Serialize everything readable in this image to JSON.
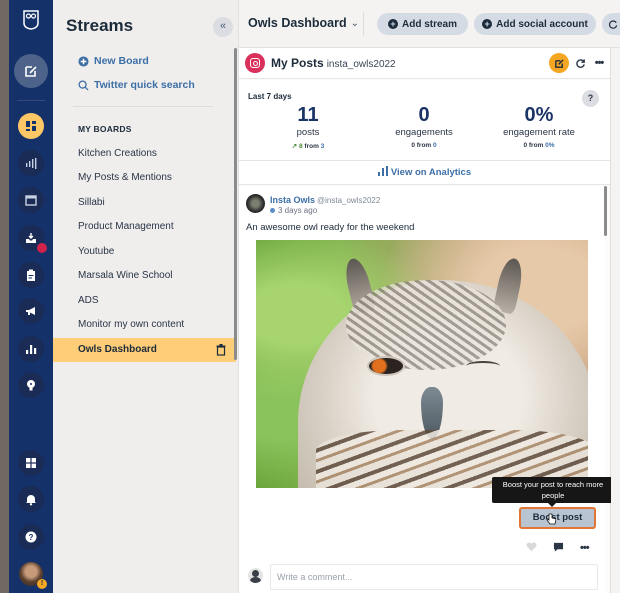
{
  "rail": {
    "items": [
      {
        "name": "logo",
        "icon": "owl-logo-icon"
      },
      {
        "name": "compose",
        "icon": "compose-icon"
      },
      {
        "name": "streams",
        "icon": "dashboard-icon",
        "active": true
      },
      {
        "name": "analytics",
        "icon": "signal-bars-icon"
      },
      {
        "name": "planner",
        "icon": "calendar-icon"
      },
      {
        "name": "inbox",
        "icon": "inbox-icon",
        "badge": true
      },
      {
        "name": "assignments",
        "icon": "clipboard-icon"
      },
      {
        "name": "advertise",
        "icon": "megaphone-icon"
      },
      {
        "name": "reports",
        "icon": "bar-chart-icon"
      },
      {
        "name": "insights",
        "icon": "lightbulb-icon"
      },
      {
        "name": "apps",
        "icon": "grid-icon"
      },
      {
        "name": "notifications",
        "icon": "bell-icon"
      },
      {
        "name": "help",
        "icon": "question-icon"
      },
      {
        "name": "profile",
        "icon": "avatar-icon",
        "warning": "!"
      }
    ],
    "colors": {
      "background": "#15316a",
      "active": "#fdc766",
      "badge": "#d0234c"
    }
  },
  "streams": {
    "title": "Streams",
    "collapse_label": "«",
    "new_board": "New Board",
    "twitter_search": "Twitter quick search",
    "boards_heading": "MY BOARDS",
    "boards": [
      {
        "label": "Kitchen Creations"
      },
      {
        "label": "My Posts & Mentions"
      },
      {
        "label": "Sillabi"
      },
      {
        "label": "Product Management"
      },
      {
        "label": "Youtube"
      },
      {
        "label": "Marsala Wine School"
      },
      {
        "label": "ADS"
      },
      {
        "label": "Monitor my own content"
      },
      {
        "label": "Owls Dashboard",
        "selected": true
      }
    ],
    "selected_color": "#fdcd78"
  },
  "topbar": {
    "dashboard_title": "Owls Dashboard",
    "dashboard_chevron": "⌄",
    "add_stream": "Add stream",
    "add_social_account": "Add social account"
  },
  "stream": {
    "network": "Instagram",
    "title": "My Posts",
    "handle": "insta_owls2022",
    "stats": {
      "period": "Last 7 days",
      "help": "?",
      "items": [
        {
          "value": "11",
          "label": "posts",
          "delta_arrow": "↗",
          "delta": "8",
          "from_word": "from",
          "previous": "3"
        },
        {
          "value": "0",
          "label": "engagements",
          "delta": "0",
          "from_word": "from",
          "previous": "0"
        },
        {
          "value": "0%",
          "label": "engagement rate",
          "delta": "0",
          "from_word": "from",
          "previous": "0%"
        }
      ]
    },
    "view_analytics": "View on Analytics",
    "post": {
      "author": "Insta Owls",
      "author_handle": "@insta_owls2022",
      "time": "3 days ago",
      "text": "An awesome owl ready for the weekend",
      "image_alt": "Close-up of a winking eagle owl",
      "tooltip": "Boost your post to reach more people",
      "boost_label": "Boost post",
      "comment_placeholder": "Write a comment..."
    }
  }
}
